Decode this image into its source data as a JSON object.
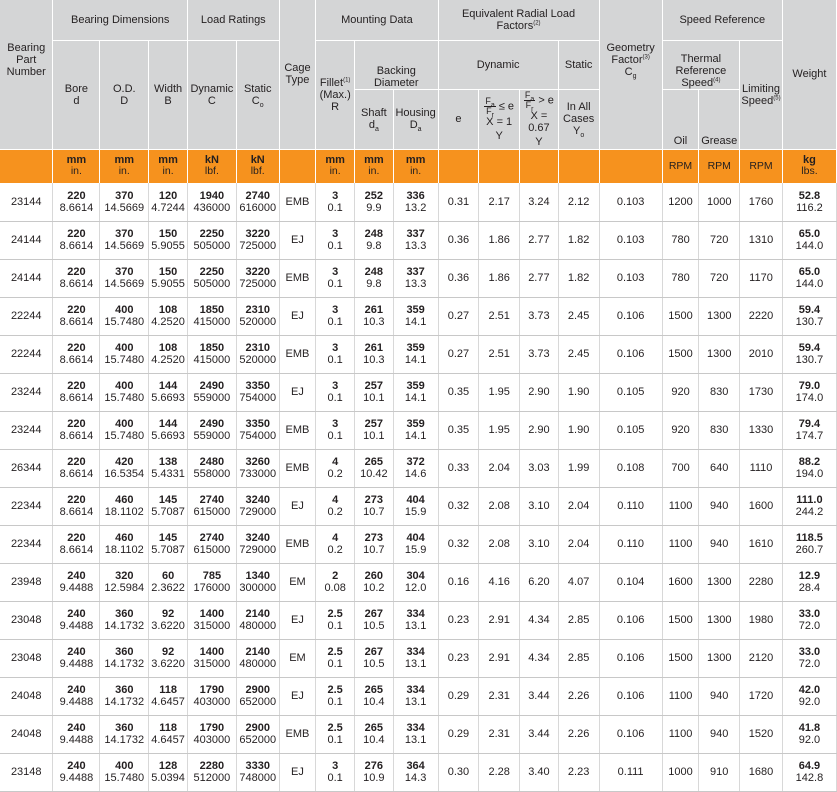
{
  "headers": {
    "part_number": "Bearing Part Number",
    "bearing_dimensions": "Bearing Dimensions",
    "load_ratings": "Load Ratings",
    "cage_type": "Cage Type",
    "mounting_data": "Mounting Data",
    "equivalent_radial_load_factors": "Equivalent Radial Load Factors",
    "equivalent_radial_load_factors_note": "(2)",
    "geometry_factor": "Geometry Factor",
    "geometry_factor_note": "(3)",
    "geometry_factor_symbol": "C",
    "geometry_factor_sub": "g",
    "speed_reference": "Speed Reference",
    "weight": "Weight",
    "bore": "Bore",
    "bore_symbol": "d",
    "od": "O.D.",
    "od_symbol": "D",
    "width": "Width",
    "width_symbol": "B",
    "dynamic": "Dynamic",
    "dynamic_symbol": "C",
    "static": "Static",
    "static_symbol": "C",
    "static_sub": "o",
    "fillet": "Fillet",
    "fillet_note": "(1)",
    "fillet_max": "(Max.)",
    "fillet_symbol": "R",
    "backing_diameter": "Backing Diameter",
    "shaft": "Shaft",
    "shaft_symbol": "d",
    "shaft_sub": "a",
    "housing": "Housing",
    "housing_symbol": "D",
    "housing_sub": "a",
    "dynamic_group": "Dynamic",
    "static_group": "Static",
    "e": "e",
    "fa": "F",
    "fa_sub": "a",
    "fr": "F",
    "fr_sub": "r",
    "le_e": "≤ e",
    "gt_e": "> e",
    "x1": "X = 1",
    "x067": "X = 0.67",
    "y": "Y",
    "in_all_cases": "In All Cases",
    "y0": "Y",
    "y0_sub": "o",
    "thermal_reference_speed": "Thermal Reference Speed",
    "thermal_note": "(4)",
    "oil": "Oil",
    "grease": "Grease",
    "limiting_speed": "Limiting Speed",
    "limiting_note": "(5)"
  },
  "units": {
    "mm": "mm",
    "in": "in.",
    "kN": "kN",
    "lbf": "lbf.",
    "rpm": "RPM",
    "kg": "kg",
    "lbs": "lbs."
  },
  "rows": [
    {
      "part": "23144",
      "bore_mm": "220",
      "bore_in": "8.6614",
      "od_mm": "370",
      "od_in": "14.5669",
      "w_mm": "120",
      "w_in": "4.7244",
      "dyn_kn": "1940",
      "dyn_lbf": "436000",
      "stat_kn": "2740",
      "stat_lbf": "616000",
      "cage": "EMB",
      "fillet_mm": "3",
      "fillet_in": "0.1",
      "shaft_mm": "252",
      "shaft_in": "9.9",
      "housing_mm": "336",
      "housing_in": "13.2",
      "e": "0.31",
      "y1": "2.17",
      "y2": "3.24",
      "y0": "2.12",
      "cg": "0.103",
      "oil": "1200",
      "grease": "1000",
      "limiting": "1760",
      "kg": "52.8",
      "lbs": "116.2"
    },
    {
      "part": "24144",
      "bore_mm": "220",
      "bore_in": "8.6614",
      "od_mm": "370",
      "od_in": "14.5669",
      "w_mm": "150",
      "w_in": "5.9055",
      "dyn_kn": "2250",
      "dyn_lbf": "505000",
      "stat_kn": "3220",
      "stat_lbf": "725000",
      "cage": "EJ",
      "fillet_mm": "3",
      "fillet_in": "0.1",
      "shaft_mm": "248",
      "shaft_in": "9.8",
      "housing_mm": "337",
      "housing_in": "13.3",
      "e": "0.36",
      "y1": "1.86",
      "y2": "2.77",
      "y0": "1.82",
      "cg": "0.103",
      "oil": "780",
      "grease": "720",
      "limiting": "1310",
      "kg": "65.0",
      "lbs": "144.0"
    },
    {
      "part": "24144",
      "bore_mm": "220",
      "bore_in": "8.6614",
      "od_mm": "370",
      "od_in": "14.5669",
      "w_mm": "150",
      "w_in": "5.9055",
      "dyn_kn": "2250",
      "dyn_lbf": "505000",
      "stat_kn": "3220",
      "stat_lbf": "725000",
      "cage": "EMB",
      "fillet_mm": "3",
      "fillet_in": "0.1",
      "shaft_mm": "248",
      "shaft_in": "9.8",
      "housing_mm": "337",
      "housing_in": "13.3",
      "e": "0.36",
      "y1": "1.86",
      "y2": "2.77",
      "y0": "1.82",
      "cg": "0.103",
      "oil": "780",
      "grease": "720",
      "limiting": "1170",
      "kg": "65.0",
      "lbs": "144.0"
    },
    {
      "part": "22244",
      "bore_mm": "220",
      "bore_in": "8.6614",
      "od_mm": "400",
      "od_in": "15.7480",
      "w_mm": "108",
      "w_in": "4.2520",
      "dyn_kn": "1850",
      "dyn_lbf": "415000",
      "stat_kn": "2310",
      "stat_lbf": "520000",
      "cage": "EJ",
      "fillet_mm": "3",
      "fillet_in": "0.1",
      "shaft_mm": "261",
      "shaft_in": "10.3",
      "housing_mm": "359",
      "housing_in": "14.1",
      "e": "0.27",
      "y1": "2.51",
      "y2": "3.73",
      "y0": "2.45",
      "cg": "0.106",
      "oil": "1500",
      "grease": "1300",
      "limiting": "2220",
      "kg": "59.4",
      "lbs": "130.7"
    },
    {
      "part": "22244",
      "bore_mm": "220",
      "bore_in": "8.6614",
      "od_mm": "400",
      "od_in": "15.7480",
      "w_mm": "108",
      "w_in": "4.2520",
      "dyn_kn": "1850",
      "dyn_lbf": "415000",
      "stat_kn": "2310",
      "stat_lbf": "520000",
      "cage": "EMB",
      "fillet_mm": "3",
      "fillet_in": "0.1",
      "shaft_mm": "261",
      "shaft_in": "10.3",
      "housing_mm": "359",
      "housing_in": "14.1",
      "e": "0.27",
      "y1": "2.51",
      "y2": "3.73",
      "y0": "2.45",
      "cg": "0.106",
      "oil": "1500",
      "grease": "1300",
      "limiting": "2010",
      "kg": "59.4",
      "lbs": "130.7"
    },
    {
      "part": "23244",
      "bore_mm": "220",
      "bore_in": "8.6614",
      "od_mm": "400",
      "od_in": "15.7480",
      "w_mm": "144",
      "w_in": "5.6693",
      "dyn_kn": "2490",
      "dyn_lbf": "559000",
      "stat_kn": "3350",
      "stat_lbf": "754000",
      "cage": "EJ",
      "fillet_mm": "3",
      "fillet_in": "0.1",
      "shaft_mm": "257",
      "shaft_in": "10.1",
      "housing_mm": "359",
      "housing_in": "14.1",
      "e": "0.35",
      "y1": "1.95",
      "y2": "2.90",
      "y0": "1.90",
      "cg": "0.105",
      "oil": "920",
      "grease": "830",
      "limiting": "1730",
      "kg": "79.0",
      "lbs": "174.0"
    },
    {
      "part": "23244",
      "bore_mm": "220",
      "bore_in": "8.6614",
      "od_mm": "400",
      "od_in": "15.7480",
      "w_mm": "144",
      "w_in": "5.6693",
      "dyn_kn": "2490",
      "dyn_lbf": "559000",
      "stat_kn": "3350",
      "stat_lbf": "754000",
      "cage": "EMB",
      "fillet_mm": "3",
      "fillet_in": "0.1",
      "shaft_mm": "257",
      "shaft_in": "10.1",
      "housing_mm": "359",
      "housing_in": "14.1",
      "e": "0.35",
      "y1": "1.95",
      "y2": "2.90",
      "y0": "1.90",
      "cg": "0.105",
      "oil": "920",
      "grease": "830",
      "limiting": "1330",
      "kg": "79.4",
      "lbs": "174.7"
    },
    {
      "part": "26344",
      "bore_mm": "220",
      "bore_in": "8.6614",
      "od_mm": "420",
      "od_in": "16.5354",
      "w_mm": "138",
      "w_in": "5.4331",
      "dyn_kn": "2480",
      "dyn_lbf": "558000",
      "stat_kn": "3260",
      "stat_lbf": "733000",
      "cage": "EMB",
      "fillet_mm": "4",
      "fillet_in": "0.2",
      "shaft_mm": "265",
      "shaft_in": "10.42",
      "housing_mm": "372",
      "housing_in": "14.6",
      "e": "0.33",
      "y1": "2.04",
      "y2": "3.03",
      "y0": "1.99",
      "cg": "0.108",
      "oil": "700",
      "grease": "640",
      "limiting": "1110",
      "kg": "88.2",
      "lbs": "194.0"
    },
    {
      "part": "22344",
      "bore_mm": "220",
      "bore_in": "8.6614",
      "od_mm": "460",
      "od_in": "18.1102",
      "w_mm": "145",
      "w_in": "5.7087",
      "dyn_kn": "2740",
      "dyn_lbf": "615000",
      "stat_kn": "3240",
      "stat_lbf": "729000",
      "cage": "EJ",
      "fillet_mm": "4",
      "fillet_in": "0.2",
      "shaft_mm": "273",
      "shaft_in": "10.7",
      "housing_mm": "404",
      "housing_in": "15.9",
      "e": "0.32",
      "y1": "2.08",
      "y2": "3.10",
      "y0": "2.04",
      "cg": "0.110",
      "oil": "1100",
      "grease": "940",
      "limiting": "1600",
      "kg": "111.0",
      "lbs": "244.2"
    },
    {
      "part": "22344",
      "bore_mm": "220",
      "bore_in": "8.6614",
      "od_mm": "460",
      "od_in": "18.1102",
      "w_mm": "145",
      "w_in": "5.7087",
      "dyn_kn": "2740",
      "dyn_lbf": "615000",
      "stat_kn": "3240",
      "stat_lbf": "729000",
      "cage": "EMB",
      "fillet_mm": "4",
      "fillet_in": "0.2",
      "shaft_mm": "273",
      "shaft_in": "10.7",
      "housing_mm": "404",
      "housing_in": "15.9",
      "e": "0.32",
      "y1": "2.08",
      "y2": "3.10",
      "y0": "2.04",
      "cg": "0.110",
      "oil": "1100",
      "grease": "940",
      "limiting": "1610",
      "kg": "118.5",
      "lbs": "260.7"
    },
    {
      "part": "23948",
      "bore_mm": "240",
      "bore_in": "9.4488",
      "od_mm": "320",
      "od_in": "12.5984",
      "w_mm": "60",
      "w_in": "2.3622",
      "dyn_kn": "785",
      "dyn_lbf": "176000",
      "stat_kn": "1340",
      "stat_lbf": "300000",
      "cage": "EM",
      "fillet_mm": "2",
      "fillet_in": "0.08",
      "shaft_mm": "260",
      "shaft_in": "10.2",
      "housing_mm": "304",
      "housing_in": "12.0",
      "e": "0.16",
      "y1": "4.16",
      "y2": "6.20",
      "y0": "4.07",
      "cg": "0.104",
      "oil": "1600",
      "grease": "1300",
      "limiting": "2280",
      "kg": "12.9",
      "lbs": "28.4"
    },
    {
      "part": "23048",
      "bore_mm": "240",
      "bore_in": "9.4488",
      "od_mm": "360",
      "od_in": "14.1732",
      "w_mm": "92",
      "w_in": "3.6220",
      "dyn_kn": "1400",
      "dyn_lbf": "315000",
      "stat_kn": "2140",
      "stat_lbf": "480000",
      "cage": "EJ",
      "fillet_mm": "2.5",
      "fillet_in": "0.1",
      "shaft_mm": "267",
      "shaft_in": "10.5",
      "housing_mm": "334",
      "housing_in": "13.1",
      "e": "0.23",
      "y1": "2.91",
      "y2": "4.34",
      "y0": "2.85",
      "cg": "0.106",
      "oil": "1500",
      "grease": "1300",
      "limiting": "1980",
      "kg": "33.0",
      "lbs": "72.0"
    },
    {
      "part": "23048",
      "bore_mm": "240",
      "bore_in": "9.4488",
      "od_mm": "360",
      "od_in": "14.1732",
      "w_mm": "92",
      "w_in": "3.6220",
      "dyn_kn": "1400",
      "dyn_lbf": "315000",
      "stat_kn": "2140",
      "stat_lbf": "480000",
      "cage": "EM",
      "fillet_mm": "2.5",
      "fillet_in": "0.1",
      "shaft_mm": "267",
      "shaft_in": "10.5",
      "housing_mm": "334",
      "housing_in": "13.1",
      "e": "0.23",
      "y1": "2.91",
      "y2": "4.34",
      "y0": "2.85",
      "cg": "0.106",
      "oil": "1500",
      "grease": "1300",
      "limiting": "2120",
      "kg": "33.0",
      "lbs": "72.0"
    },
    {
      "part": "24048",
      "bore_mm": "240",
      "bore_in": "9.4488",
      "od_mm": "360",
      "od_in": "14.1732",
      "w_mm": "118",
      "w_in": "4.6457",
      "dyn_kn": "1790",
      "dyn_lbf": "403000",
      "stat_kn": "2900",
      "stat_lbf": "652000",
      "cage": "EJ",
      "fillet_mm": "2.5",
      "fillet_in": "0.1",
      "shaft_mm": "265",
      "shaft_in": "10.4",
      "housing_mm": "334",
      "housing_in": "13.1",
      "e": "0.29",
      "y1": "2.31",
      "y2": "3.44",
      "y0": "2.26",
      "cg": "0.106",
      "oil": "1100",
      "grease": "940",
      "limiting": "1720",
      "kg": "42.0",
      "lbs": "92.0"
    },
    {
      "part": "24048",
      "bore_mm": "240",
      "bore_in": "9.4488",
      "od_mm": "360",
      "od_in": "14.1732",
      "w_mm": "118",
      "w_in": "4.6457",
      "dyn_kn": "1790",
      "dyn_lbf": "403000",
      "stat_kn": "2900",
      "stat_lbf": "652000",
      "cage": "EMB",
      "fillet_mm": "2.5",
      "fillet_in": "0.1",
      "shaft_mm": "265",
      "shaft_in": "10.4",
      "housing_mm": "334",
      "housing_in": "13.1",
      "e": "0.29",
      "y1": "2.31",
      "y2": "3.44",
      "y0": "2.26",
      "cg": "0.106",
      "oil": "1100",
      "grease": "940",
      "limiting": "1520",
      "kg": "41.8",
      "lbs": "92.0"
    },
    {
      "part": "23148",
      "bore_mm": "240",
      "bore_in": "9.4488",
      "od_mm": "400",
      "od_in": "15.7480",
      "w_mm": "128",
      "w_in": "5.0394",
      "dyn_kn": "2280",
      "dyn_lbf": "512000",
      "stat_kn": "3330",
      "stat_lbf": "748000",
      "cage": "EJ",
      "fillet_mm": "3",
      "fillet_in": "0.1",
      "shaft_mm": "276",
      "shaft_in": "10.9",
      "housing_mm": "364",
      "housing_in": "14.3",
      "e": "0.30",
      "y1": "2.28",
      "y2": "3.40",
      "y0": "2.23",
      "cg": "0.111",
      "oil": "1000",
      "grease": "910",
      "limiting": "1680",
      "kg": "64.9",
      "lbs": "142.8"
    }
  ]
}
